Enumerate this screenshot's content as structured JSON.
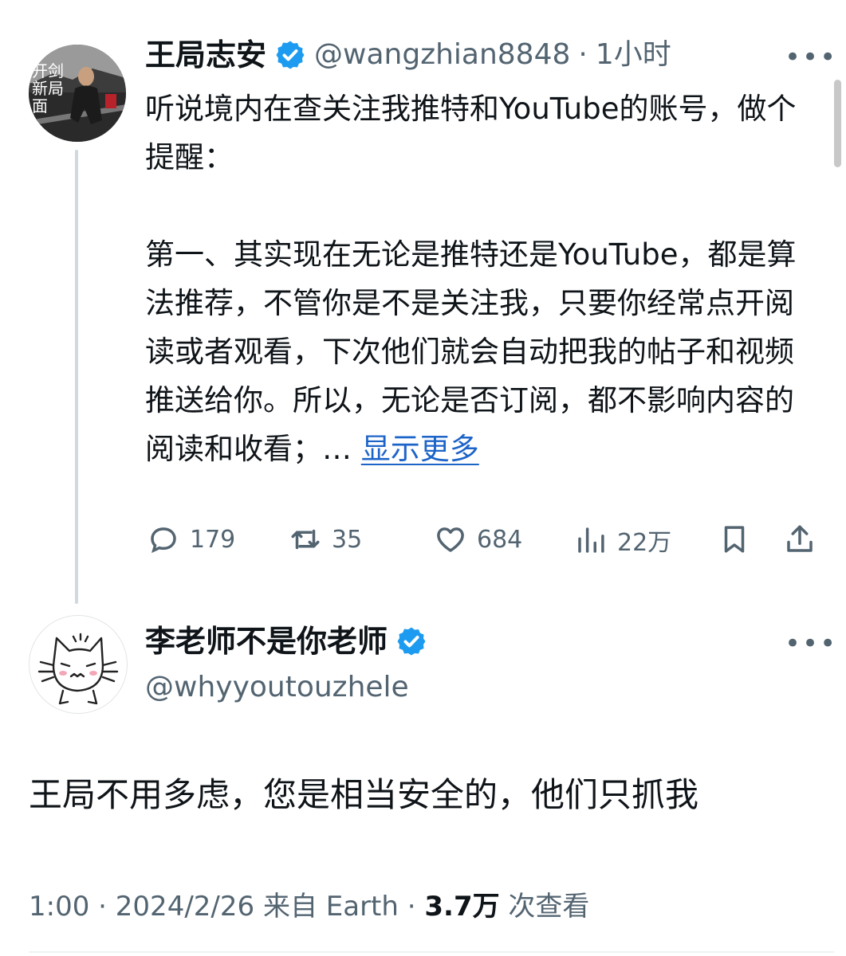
{
  "post": {
    "author_name": "王局志安",
    "handle": "@wangzhian8848",
    "separator": "·",
    "time": "1小时",
    "text": "听说境内在查关注我推特和YouTube的账号，做个提醒：\n\n第一、其实现在无论是推特还是YouTube，都是算法推荐，不管你是不是关注我，只要你经常点开阅读或者观看，下次他们就会自动把我的帖子和视频推送给你。所以，无论是否订阅，都不影响内容的阅读和收看；",
    "ellipsis": "… ",
    "show_more": "显示更多",
    "more_label": "•••",
    "avatar_text": "开剑新局面",
    "stats": {
      "replies": "179",
      "retweets": "35",
      "likes": "684",
      "views": "22万"
    }
  },
  "reply": {
    "author_name": "李老师不是你老师",
    "handle": "@whyyoutouzhele",
    "more_label": "•••",
    "text": "王局不用多虑，您是相当安全的，他们只抓我",
    "time": "1:00",
    "sep1": "·",
    "date": "2024/2/26",
    "source": "来自 Earth",
    "sep2": "·",
    "view_count": "3.7万",
    "view_label": "次查看"
  },
  "colors": {
    "text": "#0f1419",
    "secondary": "#536471",
    "link": "#1d64c8",
    "verified_badge": "#1d9bf0",
    "thread_line": "#cfd9de"
  },
  "icons": [
    "verified-badge-icon",
    "more-icon",
    "reply-icon",
    "retweet-icon",
    "like-icon",
    "views-icon",
    "bookmark-icon",
    "share-icon"
  ]
}
